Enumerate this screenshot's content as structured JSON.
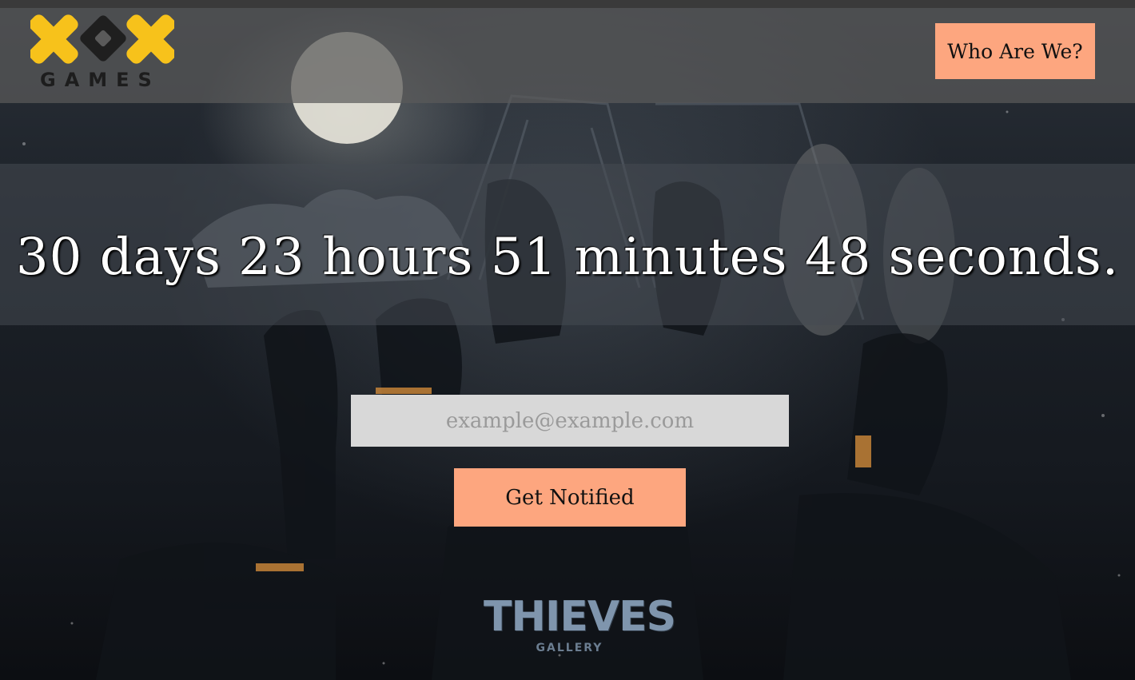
{
  "brand": {
    "logo_text": "GAMES",
    "accent_color": "#f7c21b"
  },
  "header": {
    "who_button_label": "Who Are We?"
  },
  "countdown": {
    "text": "30 days 23 hours 51 minutes 48 seconds."
  },
  "signup": {
    "email_placeholder": "example@example.com",
    "email_value": "",
    "button_label": "Get Notified",
    "button_color": "#fda67f"
  },
  "footer_logo": {
    "title": "THIEVES",
    "subtitle": "GALLERY"
  }
}
